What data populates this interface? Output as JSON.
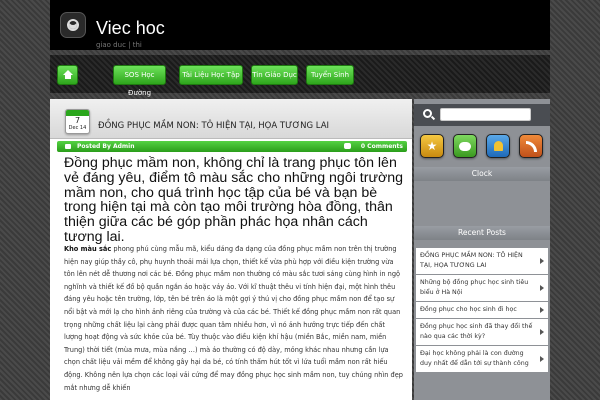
{
  "header": {
    "title": "Viec hoc",
    "description": "giao duc | thi"
  },
  "nav": {
    "items": [
      "SOS Học Đường",
      "Tài Liệu Học Tập",
      "Tin Giáo Dục",
      "Tuyển Sinh"
    ]
  },
  "post": {
    "date_day": "7",
    "date_month": "Dec 14",
    "title": "ĐỒNG PHỤC MẦM NON: TÔ HIỆN TẠI, HỌA TƯƠNG LAI",
    "author_label": "Posted By Admin",
    "comments_label": "0 Comments",
    "lede": "Đồng phục mầm non, không chỉ là trang phục tôn lên vẻ đáng yêu, điểm tô màu sắc cho những ngôi trường mầm non, cho quá trình học tập của bé và bạn bè trong hiện tại mà còn tạo môi trường hòa đồng, thân thiện giữa các bé góp phần phác họa nhân cách tương lai.",
    "body_strong": "Kho màu sắc",
    "body": " phong phú cùng mẫu mã, kiểu dáng đa dạng của đồng phục mầm non trên thị trường hiện nay giúp thầy cô, phụ huynh thoải mái lựa chọn, thiết kế vừa phù hợp với điều kiện trường vừa tôn lên nét dễ thương nơi các bé. Đồng phục mầm non thường có màu sắc tươi sáng cùng hình in ngộ nghĩnh và thiết kế đồ bộ quần ngắn áo hoặc váy áo. Với kĩ thuật thêu vi tính hiện đại, một hình thêu đáng yêu hoặc tên trường, lớp, tên bé trên áo là một gợi ý thú vị cho đồng phục mầm non để tạo sự nổi bật và mới lạ cho hình ảnh riêng của trường và của các bé. Thiết kế đồng phục mầm non rất quan trọng những chất liệu lại càng phải được quan tâm nhiều hơn, vì nó ảnh hưởng trực tiếp đến chất lượng hoạt động và sức khỏe của bé. Tùy thuộc vào điều kiện khí hậu (miền Bắc, miền nam, miền Trung) thời tiết (mùa mưa, mùa nắng …) mà áo thường có độ dày, mỏng khác nhau nhưng cần lựa chọn chất liệu vải mềm để không gây hại da bé, có tính thấm hút tốt vì lứa tuổi mầm non rất hiếu động. Không nên lựa chọn các loại vải cứng để may đồng phục học sinh mầm non, tuy chúng nhìn đẹp mắt nhưng dễ khiến"
  },
  "sidebar": {
    "search_placeholder": "",
    "social_icons": [
      "star-icon",
      "chat-icon",
      "bell-icon",
      "rss-icon"
    ],
    "clock_title": "Clock",
    "recent_title": "Recent Posts",
    "recent_posts": [
      "ĐỒNG PHỤC MẦM NON: TÔ HIỆN TẠI, HỌA TƯƠNG LAI",
      "Những bộ đồng phục học sinh tiêu biểu ở Hà Nội",
      "Đồng phục cho học sinh đi học",
      "Đồng phục học sinh đã thay đổi thế nào qua các thời kỳ?",
      "Đại học không phải là con đường duy nhất để dẫn tới sự thành công"
    ]
  },
  "colors": {
    "accent_green": "#2ea51c",
    "header_bg": "#000000",
    "sidebar_bg": "#8e9196"
  }
}
